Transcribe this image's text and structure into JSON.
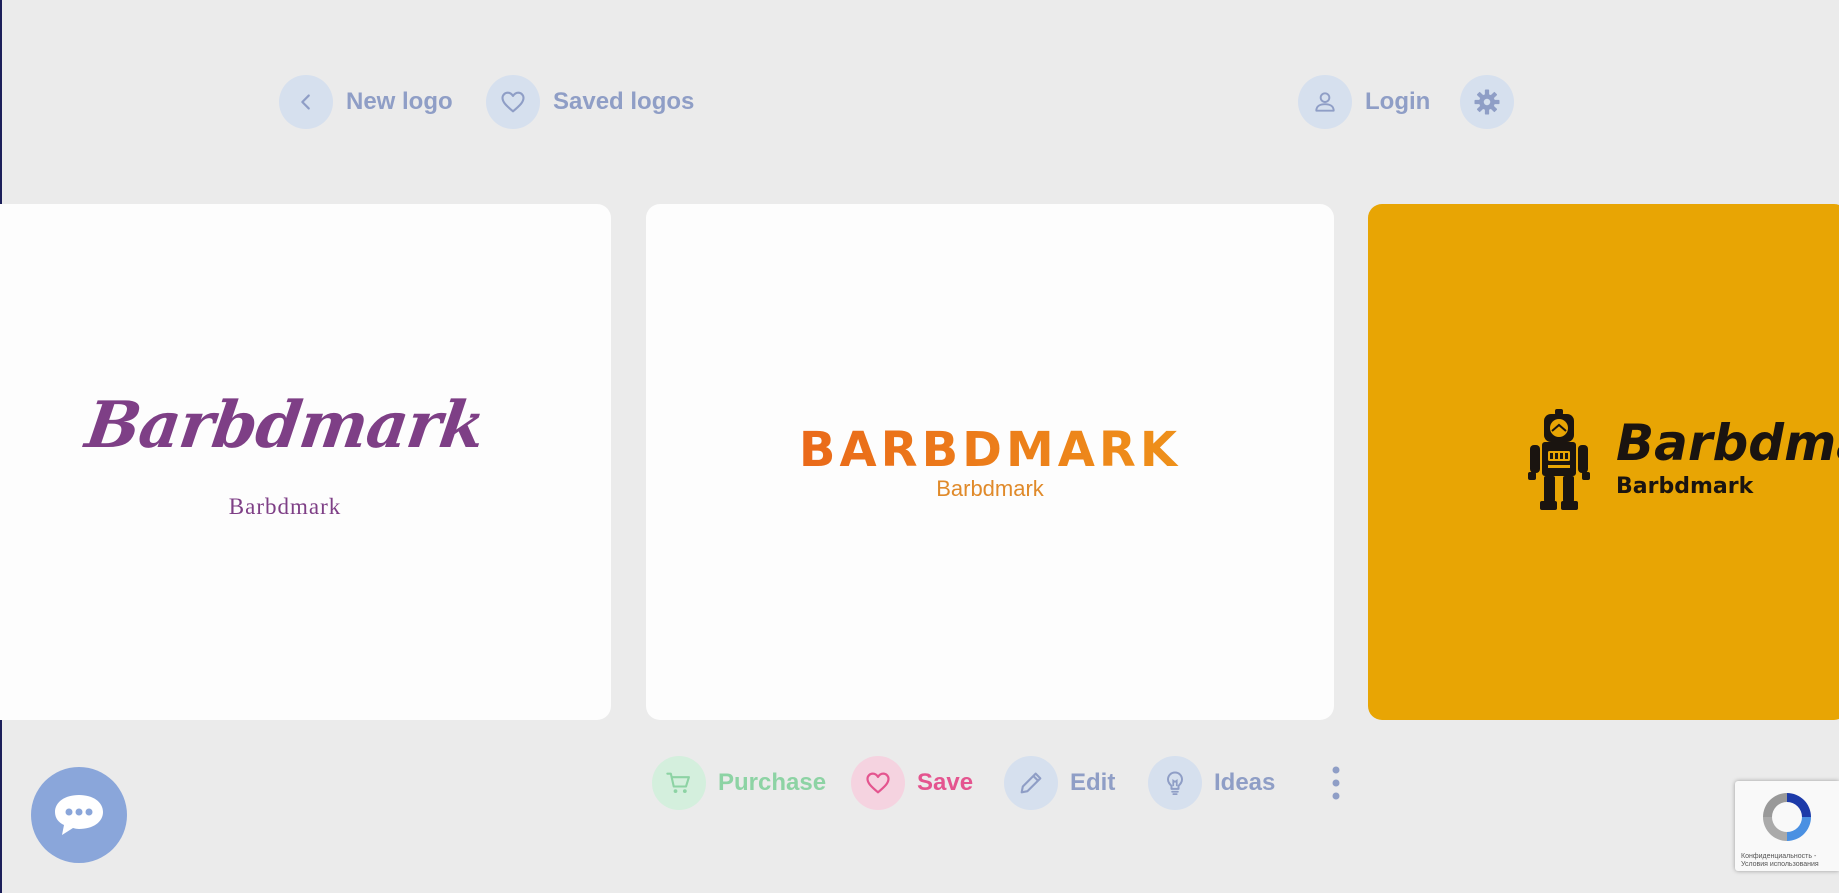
{
  "nav": {
    "new_logo": "New logo",
    "saved_logos": "Saved logos",
    "login": "Login"
  },
  "cards": [
    {
      "title": "Barbdmark",
      "subtitle": "Barbdmark",
      "background": "#fdfdfd",
      "color": "#7e3f86"
    },
    {
      "title": "BARBDMARK",
      "subtitle": "Barbdmark",
      "background": "#fdfdfd",
      "color": "#ec7a1c"
    },
    {
      "title": "Barbdma",
      "subtitle": "Barbdmark",
      "background": "#e8a504",
      "color": "#1a1410",
      "icon": "robot-icon"
    }
  ],
  "actions": {
    "purchase": "Purchase",
    "save": "Save",
    "edit": "Edit",
    "ideas": "Ideas"
  },
  "colors": {
    "accent_nav": "#8f9ec6",
    "purchase": "#8dd3a4",
    "save": "#e4558f",
    "chat": "#8aa6da"
  },
  "recaptcha": {
    "text": "Конфиденциальность - Условия использования"
  }
}
